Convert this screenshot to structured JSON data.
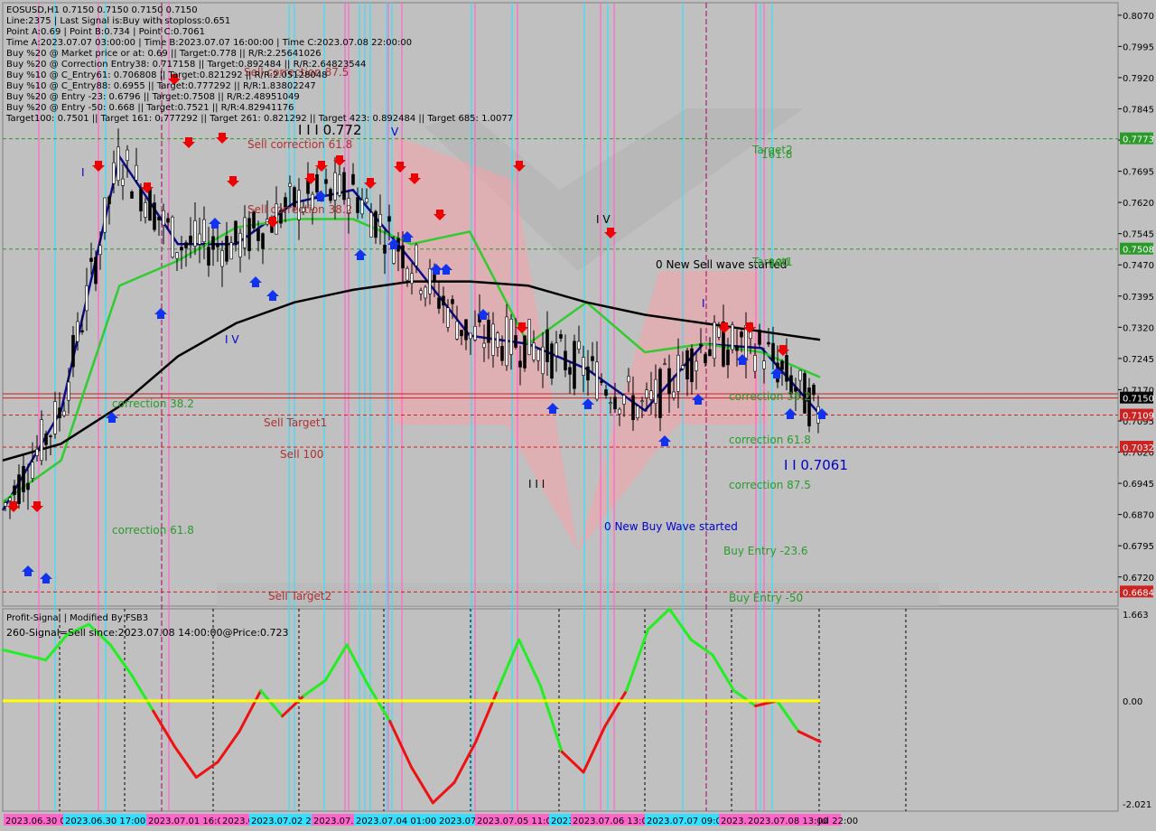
{
  "header": {
    "lines": [
      "EOSUSD,H1  0.7150 0.7150 0.7150 0.7150",
      "Line:2375 | Last Signal is:Buy with stoploss:0.651",
      "Point A:0.69 | Point B:0.734 | Point C:0.7061",
      "Time A:2023.07.07 03:00:00 | Time B:2023.07.07 16:00:00 | Time C:2023.07.08 22:00:00",
      "Buy %20 @ Market price or at: 0.69 || Target:0.778 || R/R:2.25641026",
      "Buy %20 @ Correction Entry38: 0.717158 || Target:0.892484 || R/R:2.64823544",
      "Buy %10 @ C_Entry61: 0.706808 || Target:0.821292 || R/R:2.05128048",
      "Buy %10 @ C_Entry88: 0.6955 || Target:0.777292 || R/R:1.83802247",
      "Buy %20 @ Entry -23: 0.6796 || Target:0.7508 || R/R:2.48951049",
      "Buy %20 @ Entry -50: 0.668 || Target:0.7521 || R/R:4.82941176",
      "Target100: 0.7501 || Target 161: 0.777292 || Target 261: 0.821292 || Target 423: 0.892484 || Target 685: 1.0077"
    ]
  },
  "colors": {
    "background": "#c0c0c0",
    "bull_candle": "#000000",
    "bear_candle": "#000000",
    "ma_fast": "#0a0a8c",
    "ma_mid": "#2ecc2e",
    "ma_slow": "#000000",
    "level_red": "#cc2222",
    "level_green": "#2a9a2a",
    "cyan_line": "#33e0ff",
    "pink_line": "#ff66cc",
    "osc_up": "#22ee22",
    "osc_down": "#ee1111",
    "osc_zero": "#ffff00"
  },
  "main_chart": {
    "y_axis_ticks": [
      "0.8070",
      "0.7995",
      "0.7920",
      "0.7845",
      "0.7770",
      "0.7695",
      "0.7620",
      "0.7545",
      "0.7470",
      "0.7395",
      "0.7320",
      "0.7245",
      "0.7170",
      "0.7095",
      "0.7020",
      "0.6945",
      "0.6870",
      "0.6795",
      "0.6720"
    ],
    "price_tags": [
      {
        "label": "0.7773",
        "color": "#2a9a2a",
        "price": 0.7773
      },
      {
        "label": "0.7508",
        "color": "#2a9a2a",
        "price": 0.7508
      },
      {
        "label": "0.7150",
        "color": "#000000",
        "price": 0.715
      },
      {
        "label": "0.7109",
        "color": "#cc2222",
        "price": 0.7109
      },
      {
        "label": "0.7032",
        "color": "#cc2222",
        "price": 0.7032
      },
      {
        "label": "0.6684",
        "color": "#cc2222",
        "price": 0.6684
      }
    ],
    "annotations": [
      {
        "text": "Sell correction 87.5",
        "color": "#b03030"
      },
      {
        "text": "Sell correction 61.8",
        "color": "#b03030"
      },
      {
        "text": "Sell correction 38.2",
        "color": "#b03030"
      },
      {
        "text": "correction 38.2",
        "color": "#2a9a2a"
      },
      {
        "text": "Sell Target1",
        "color": "#b03030"
      },
      {
        "text": "Sell 100",
        "color": "#b03030"
      },
      {
        "text": "correction 61.8",
        "color": "#2a9a2a"
      },
      {
        "text": "Sell Target2",
        "color": "#b03030"
      },
      {
        "text": "I I I 0.772",
        "color": "#000000"
      },
      {
        "text": "0 New Sell wave started",
        "color": "#000000"
      },
      {
        "text": "0 New Buy Wave started",
        "color": "#0000cc"
      },
      {
        "text": "Target2",
        "color": "#2a9a2a"
      },
      {
        "text": "161.8",
        "color": "#2a9a2a"
      },
      {
        "text": "Target1",
        "color": "#2a9a2a"
      },
      {
        "text": "100",
        "color": "#2a9a2a"
      },
      {
        "text": "correction 38.2",
        "color": "#2a9a2a"
      },
      {
        "text": "correction 61.8",
        "color": "#2a9a2a"
      },
      {
        "text": "correction 87.5",
        "color": "#2a9a2a"
      },
      {
        "text": "I I 0.7061",
        "color": "#0000cc"
      },
      {
        "text": "Buy Entry -23.6",
        "color": "#2a9a2a"
      },
      {
        "text": "Buy Entry -50",
        "color": "#2a9a2a"
      },
      {
        "text": "I V",
        "color": "#0000cc"
      },
      {
        "text": "V",
        "color": "#0000cc"
      },
      {
        "text": "I V",
        "color": "#000000"
      },
      {
        "text": "I",
        "color": "#0000cc"
      },
      {
        "text": "I",
        "color": "#0000cc"
      },
      {
        "text": "I I I",
        "color": "#000000"
      }
    ]
  },
  "oscillator": {
    "title": "Profit-Signal | Modified By FSB3",
    "signal_text": "260-Signal=Sell since:2023.07.08 14:00:00@Price:0.723",
    "y_axis_ticks": [
      "1.663",
      "0.00",
      "-2.021"
    ]
  },
  "x_axis": {
    "labels": [
      {
        "text": "2023.06.30 00:00",
        "bg": "#ff66cc"
      },
      {
        "text": "2023.06.30 17:00",
        "bg": "#33e0ff"
      },
      {
        "text": "2023.07.01 16:00",
        "bg": "#ff66cc"
      },
      {
        "text": "2023.07.02 04:00",
        "bg": "#ff66cc"
      },
      {
        "text": "2023.07.02 20:00",
        "bg": "#33e0ff"
      },
      {
        "text": "2023.07.03 09:00",
        "bg": "#ff66cc"
      },
      {
        "text": "2023.07.04 01:00",
        "bg": "#33e0ff"
      },
      {
        "text": "2023.07.05 02:00",
        "bg": "#33e0ff"
      },
      {
        "text": "2023.07.05 11:00",
        "bg": "#ff66cc"
      },
      {
        "text": "2023.07.06 00:00",
        "bg": "#33e0ff"
      },
      {
        "text": "2023.07.06 13:00",
        "bg": "#ff66cc"
      },
      {
        "text": "2023.07.07 09:00",
        "bg": "#33e0ff"
      },
      {
        "text": "2023.07.08 00:00",
        "bg": "#ff66cc"
      },
      {
        "text": "2023.07.08 13:00",
        "bg": "#ff66cc"
      },
      {
        "text": "Jul 22:00",
        "bg": ""
      }
    ]
  },
  "chart_data": {
    "type": "line",
    "symbol": "EOSUSD",
    "timeframe": "H1",
    "ylim": [
      0.665,
      0.81
    ],
    "x": [
      "06-30 00:00",
      "06-30 17:00",
      "07-01 16:00",
      "07-02 04:00",
      "07-02 20:00",
      "07-03 09:00",
      "07-04 01:00",
      "07-05 02:00",
      "07-05 11:00",
      "07-06 00:00",
      "07-06 13:00",
      "07-07 09:00",
      "07-08 00:00",
      "07-08 13:00",
      "07-08 22:00"
    ],
    "series": [
      {
        "values": [
          0.688,
          0.712,
          0.773,
          0.752,
          0.752,
          0.762,
          0.765,
          0.748,
          0.73,
          0.728,
          0.722,
          0.712,
          0.728,
          0.727,
          0.711
        ]
      },
      {
        "values": [
          0.69,
          0.7,
          0.742,
          0.748,
          0.756,
          0.758,
          0.758,
          0.752,
          0.755,
          0.728,
          0.738,
          0.726,
          0.728,
          0.726,
          0.72
        ]
      },
      {
        "values": [
          0.7,
          0.704,
          0.713,
          0.725,
          0.733,
          0.738,
          0.741,
          0.743,
          0.743,
          0.742,
          0.738,
          0.735,
          0.733,
          0.731,
          0.729
        ]
      }
    ],
    "oscillator": {
      "ylim": [
        -2.021,
        1.663
      ],
      "values": [
        1.0,
        0.9,
        0.8,
        1.3,
        1.5,
        1.1,
        0.5,
        -0.2,
        -0.9,
        -1.5,
        -1.2,
        -0.6,
        0.2,
        -0.3,
        0.1,
        0.4,
        1.1,
        0.3,
        -0.4,
        -1.3,
        -2.0,
        -1.6,
        -0.8,
        0.2,
        1.2,
        0.3,
        -1.0,
        -1.4,
        -0.5,
        0.2,
        1.4,
        1.8,
        1.2,
        0.9,
        0.2,
        -0.1,
        0.0,
        -0.6,
        -0.8
      ]
    },
    "levels": [
      0.7773,
      0.7508,
      0.715,
      0.7109,
      0.7032,
      0.6684
    ]
  }
}
